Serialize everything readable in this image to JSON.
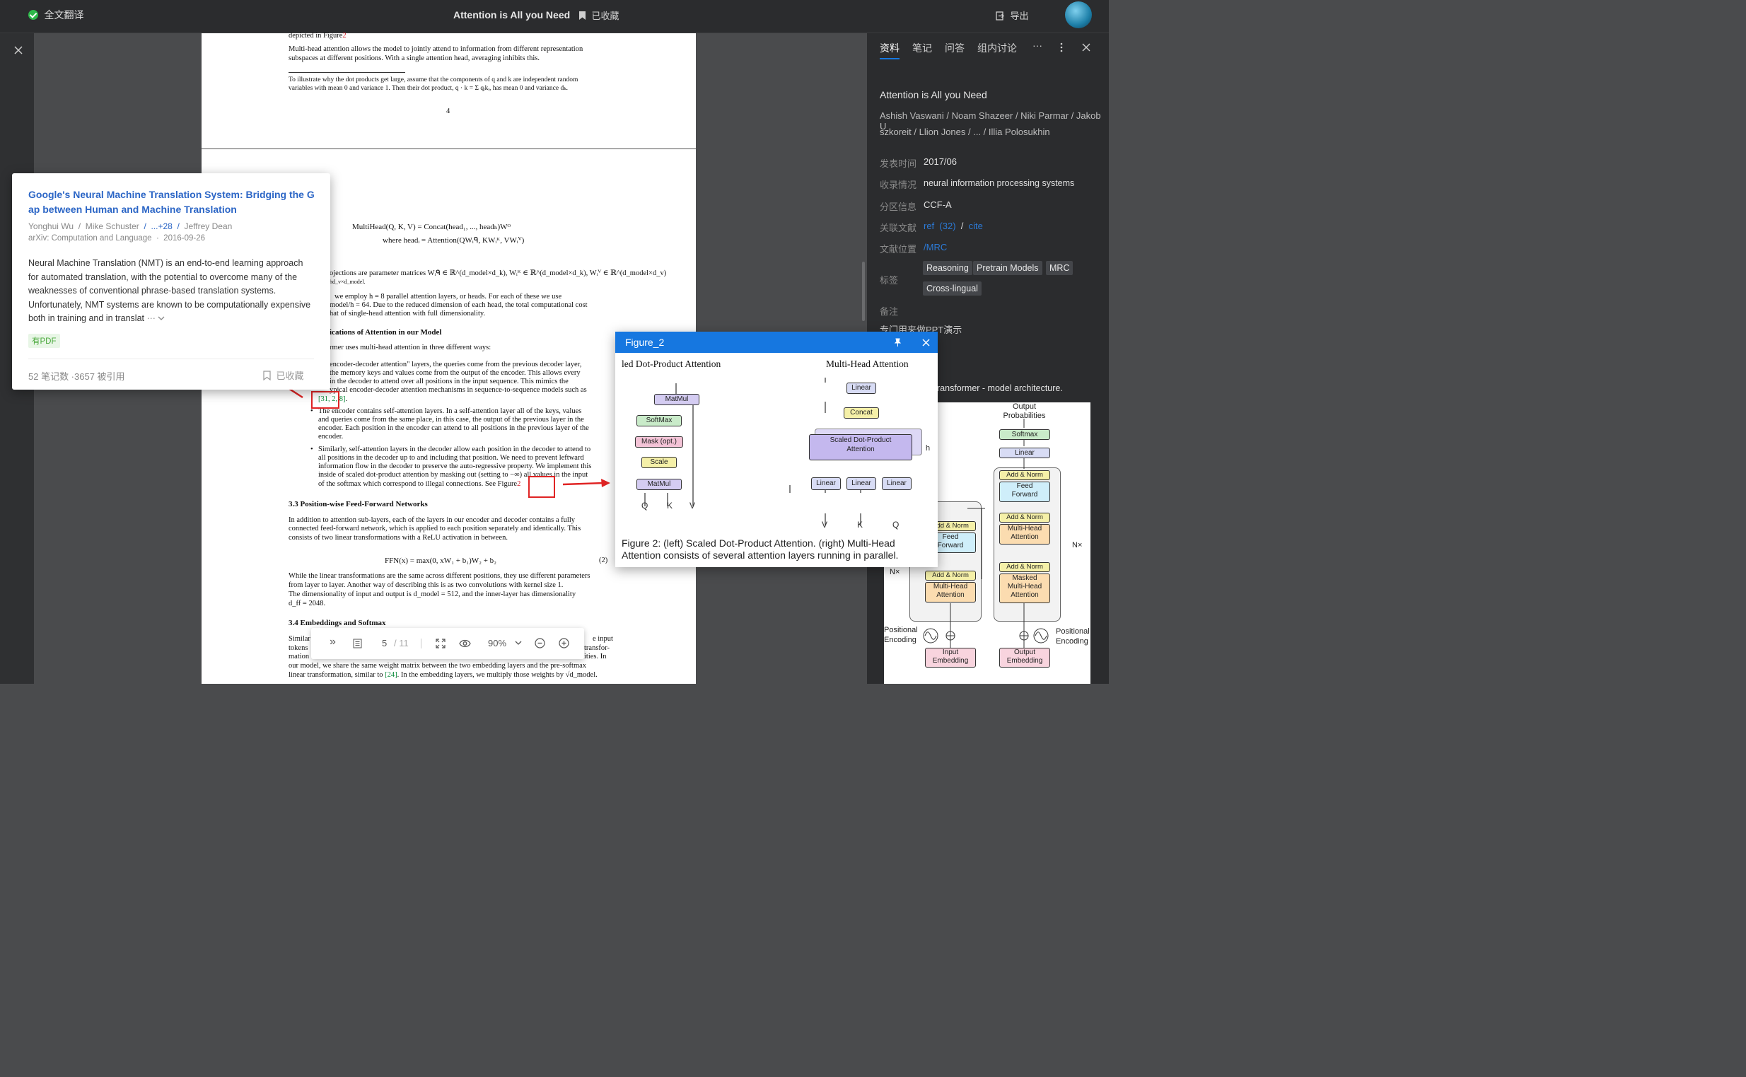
{
  "topbar": {
    "translate": "全文翻译",
    "title": "Attention is All you Need",
    "collected": "已收藏",
    "export": "导出"
  },
  "paper_top": {
    "l1": "depicted in Figure",
    "l1ref": "2",
    "l2": "Multi-head attention allows the model to jointly attend to information from different representation",
    "l3": "subspaces at different positions. With a single attention head, averaging inhibits this.",
    "fn1": "To illustrate why the dot products get large, assume that the components of q and k are independent random",
    "fn2": "variables with mean 0 and variance 1. Then their dot product, q · k = Σ qᵢkᵢ, has mean 0 and variance dₖ.",
    "page_num": "4"
  },
  "paper": {
    "eq1": "MultiHead(Q, K, V) = Concat(head₁, ..., headₕ)Wᴼ",
    "eq2": "where headᵢ = Attention(QWᵢᑫ, KWᵢᴷ, VWᵢⱽ)",
    "p1a": "ojections are parameter matrices Wᵢᑫ ∈ ℝ^(d_model×d_k), Wᵢᴷ ∈ ℝ^(d_model×d_k), Wᵢⱽ ∈ ℝ^(d_model×d_v)",
    "p1b": "hd_v×d_model.",
    "p2a": "we employ h = 8 parallel attention layers, or heads. For each of these we use",
    "p2b": "model/h = 64. Due to the reduced dimension of each head, the total computational cost",
    "p2c": "hat of single-head attention with full dimensionality.",
    "h1": "ications of Attention in our Model",
    "p3": "rmer uses multi-head attention in three different ways:",
    "b1a": "encoder-decoder attention\" layers, the queries come from the previous decoder layer,",
    "b1b": "the memory keys and values come from the output of the encoder. This allows every",
    "b1c": "in the decoder to attend over all positions in the input sequence. This mimics the",
    "b1d": "ypical encoder-decoder attention mechanisms in sequence-to-sequence models such as",
    "b1e_refs": "[31, 2, 8]",
    "b1e_tail": ".",
    "b2a": "The encoder contains self-attention layers. In a self-attention layer all of the keys, values",
    "b2b": "and queries come from the same place, in this case, the output of the previous layer in the",
    "b2c": "encoder. Each position in the encoder can attend to all positions in the previous layer of the",
    "b2d": "encoder.",
    "b3a": "Similarly, self-attention layers in the decoder allow each position in the decoder to attend to",
    "b3b": "all positions in the decoder up to and including that position. We need to prevent leftward",
    "b3c": "information flow in the decoder to preserve the auto-regressive property. We implement this",
    "b3d": "inside of scaled dot-product attention by masking out (setting to −∞) all values in the input",
    "b3e": "of the softmax which correspond to illegal connections. See Figure",
    "b3e_ref": "2",
    "h2": "3.3   Position-wise Feed-Forward Networks",
    "p4a": "In addition to attention sub-layers, each of the layers in our encoder and decoder contains a fully",
    "p4b": "connected feed-forward network, which is applied to each position separately and identically. This",
    "p4c": "consists of two linear transformations with a ReLU activation in between.",
    "eq3": "FFN(x) = max(0, xW₁ + b₁)W₂ + b₂",
    "eq3num": "(2)",
    "p5a": "While the linear transformations are the same across different positions, they use different parameters",
    "p5b": "from layer to layer. Another way of describing this is as two convolutions with kernel size 1.",
    "p5c": "The dimensionality of input and output is d_model = 512, and the inner-layer has dimensionality",
    "p5d": "d_ff = 2048.",
    "h3": "3.4   Embeddings and Softmax",
    "p6a": "Similar",
    "p6a_tail": "e input",
    "p6b": "tokens",
    "p6b_tail": "transfor-",
    "p6c": "mation",
    "p6c_tail": "ities. In",
    "p6d": "our model, we share the same weight matrix between the two embedding layers and the pre-softmax",
    "p6e": "linear transformation, similar to ",
    "p6e_ref": "[24]",
    "p6e_tail": ". In the embedding layers, we multiply those weights by √d_model."
  },
  "popup": {
    "title": "Google's Neural Machine Translation System: Bridging the Gap between Human and Machine Translation",
    "author1": "Yonghui Wu",
    "sep": "/",
    "author2": "Mike Schuster",
    "more": "...+28",
    "author3": "Jeffrey Dean",
    "venue": "arXiv: Computation and Language",
    "dot": "·",
    "date": "2016-09-26",
    "abstract": "Neural Machine Translation (NMT) is an end-to-end learning approach for automated translation, with the potential to overcome many of the weaknesses of conventional phrase-based translation systems. Unfortunately, NMT systems are known to be computationally expensive both in training and in translat",
    "ellipsis": "···",
    "pdf_badge": "有PDF",
    "stats": "52 笔记数 ·3657 被引用",
    "collected": "已收藏"
  },
  "rpanel": {
    "tabs": [
      "资料",
      "笔记",
      "问答",
      "组内讨论"
    ],
    "more": "···",
    "title": "Attention is All you Need",
    "authors1": "Ashish Vaswani / Noam Shazeer / Niki Parmar / Jakob U",
    "authors2": "szkoreit / Llion Jones / ... / Illia Polosukhin",
    "pub_label": "发表时间",
    "pub_value": "2017/06",
    "venue_label": "收录情况",
    "venue_value": "neural information processing systems",
    "rank_label": "分区信息",
    "rank_value": "CCF-A",
    "refs_label": "关联文献",
    "refs_ref": "ref",
    "refs_count": "(32)",
    "refs_sep": "/",
    "refs_cite": "cite",
    "loc_label": "文献位置",
    "loc_value": "/MRC",
    "tags_label": "标签",
    "tags": [
      "Reasoning",
      "Pretrain Models",
      "MRC",
      "Cross-lingual"
    ],
    "note_label": "备注",
    "note_value": "专门用来做PPT演示",
    "fig_caption": "ransformer - model architecture."
  },
  "transformer": {
    "output_probs": "Output\nProbabilities",
    "softmax": "Softmax",
    "linear": "Linear",
    "addnorm": "Add & Norm",
    "ffwd": "Feed\nForward",
    "mha": "Multi-Head\nAttention",
    "masked_mha": "Masked\nMulti-Head\nAttention",
    "nx": "N×",
    "pos_enc": "Positional\nEncoding",
    "input_emb": "Input\nEmbedding",
    "output_emb": "Output\nEmbedding"
  },
  "figure": {
    "title": "Figure_2",
    "left_title": "led Dot-Product Attention",
    "right_title": "Multi-Head Attention",
    "matmul": "MatMul",
    "softmax": "SoftMax",
    "mask": "Mask (opt.)",
    "scale": "Scale",
    "linear": "Linear",
    "concat": "Concat",
    "sdpa": "Scaled Dot-Product\nAttention",
    "h": "h",
    "q": "Q",
    "k": "K",
    "v": "V",
    "caption": "Figure 2: (left) Scaled Dot-Product Attention. (right) Multi-Head Attention consists of several attention layers running in parallel."
  },
  "toolbar": {
    "page": "5",
    "total": "/ 11",
    "zoom": "90%"
  },
  "colors": {
    "accent": "#1677e0",
    "link": "#2c66c6",
    "red": "#e02424",
    "tag_bg": "#44464a"
  }
}
